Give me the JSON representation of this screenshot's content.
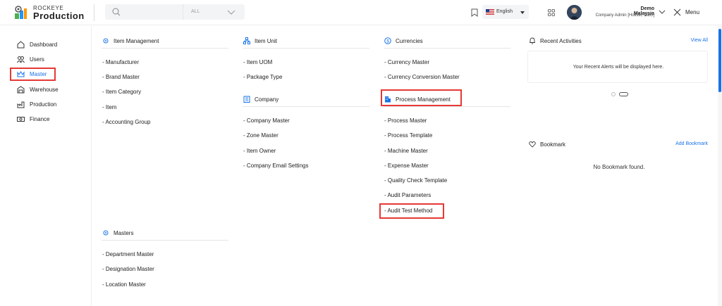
{
  "header": {
    "brand_small": "ROCKEYE",
    "brand_large": "Production",
    "search": {
      "placeholder": "",
      "filter": "ALL"
    },
    "language": "English",
    "user": {
      "name": "Demo Malaysia",
      "role": "Company Admin [Holistic O&G]"
    },
    "menu_label": "Menu"
  },
  "sidebar": {
    "items": [
      {
        "label": "Dashboard",
        "icon": "home-icon"
      },
      {
        "label": "Users",
        "icon": "users-icon"
      },
      {
        "label": "Master",
        "icon": "crown-icon",
        "active": true
      },
      {
        "label": "Warehouse",
        "icon": "warehouse-icon"
      },
      {
        "label": "Production",
        "icon": "factory-icon"
      },
      {
        "label": "Finance",
        "icon": "money-icon"
      }
    ]
  },
  "sections": {
    "item_management": {
      "title": "Item Management",
      "links": [
        "- Manufacturer",
        "- Brand Master",
        "- Item Category",
        "- Item",
        "- Accounting Group"
      ]
    },
    "masters": {
      "title": "Masters",
      "links": [
        "- Department Master",
        "- Designation Master",
        "- Location Master"
      ]
    },
    "item_unit": {
      "title": "Item Unit",
      "links": [
        "- Item UOM",
        "- Package Type"
      ]
    },
    "company": {
      "title": "Company",
      "links": [
        "- Company Master",
        "- Zone Master",
        "- Item Owner",
        "- Company Email Settings"
      ]
    },
    "currencies": {
      "title": "Currencies",
      "links": [
        "- Currency Master",
        "- Currency Conversion Master"
      ]
    },
    "process_management": {
      "title": "Process Management",
      "links": [
        "- Process Master",
        "- Process Template",
        "- Machine Master",
        "- Expense Master",
        "- Quality Check Template",
        "- Audit Parameters",
        "- Audit Test Method"
      ]
    }
  },
  "recent": {
    "title": "Recent Activities",
    "action": "View All",
    "message": "Your Recent Alerts will be displayed here."
  },
  "bookmark": {
    "title": "Bookmark",
    "action": "Add Bookmark",
    "message": "No Bookmark found."
  },
  "colors": {
    "accent": "#1a73e8",
    "highlight": "#e53935"
  }
}
